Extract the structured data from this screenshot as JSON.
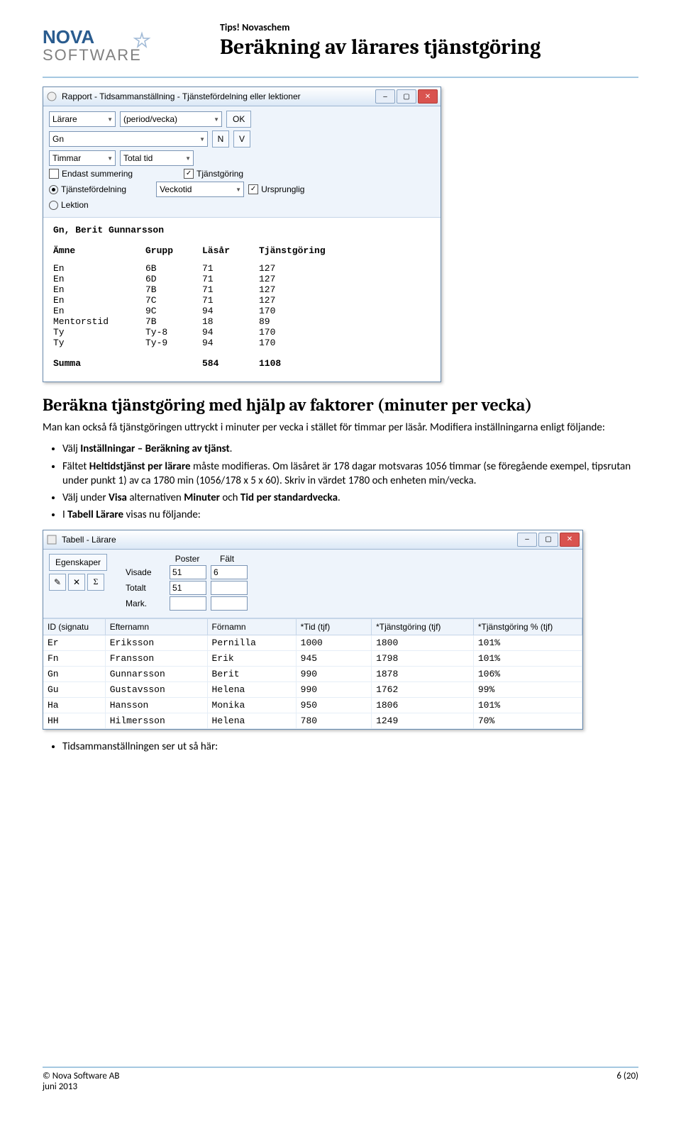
{
  "header": {
    "tips": "Tips! Novaschem",
    "title": "Beräkning av lärares tjänstgöring",
    "logo_top": "NOVA",
    "logo_bottom": "SOFTWARE"
  },
  "window1": {
    "title": "Rapport - Tidsammanställning - Tjänstefördelning eller lektioner",
    "dd_larare": "Lärare",
    "dd_period": "(period/vecka)",
    "btn_ok": "OK",
    "dd_gn": "Gn",
    "btn_n": "N",
    "btn_v": "V",
    "dd_timmar": "Timmar",
    "dd_totaltid": "Total tid",
    "chk_endast": "Endast summering",
    "chk_tjg": "Tjänstgöring",
    "radio_tjf": "Tjänstefördelning",
    "radio_lekt": "Lektion",
    "dd_veckotid": "Veckotid",
    "chk_urspr": "Ursprunglig",
    "teacher": "Gn, Berit Gunnarsson",
    "cols": {
      "amne": "Ämne",
      "grupp": "Grupp",
      "lasar": "Läsår",
      "tjg": "Tjänstgöring"
    },
    "rows": [
      {
        "a": "En",
        "g": "6B",
        "l": "71",
        "t": "127"
      },
      {
        "a": "En",
        "g": "6D",
        "l": "71",
        "t": "127"
      },
      {
        "a": "En",
        "g": "7B",
        "l": "71",
        "t": "127"
      },
      {
        "a": "En",
        "g": "7C",
        "l": "71",
        "t": "127"
      },
      {
        "a": "En",
        "g": "9C",
        "l": "94",
        "t": "170"
      },
      {
        "a": "Mentorstid",
        "g": "7B",
        "l": "18",
        "t": "89"
      },
      {
        "a": "Ty",
        "g": "Ty-8",
        "l": "94",
        "t": "170"
      },
      {
        "a": "Ty",
        "g": "Ty-9",
        "l": "94",
        "t": "170"
      }
    ],
    "sum_label": "Summa",
    "sum_l": "584",
    "sum_t": "1108"
  },
  "section": {
    "title": "Beräkna tjänstgöring med hjälp av faktorer (minuter per vecka)",
    "para": "Man kan också få tjänstgöringen uttryckt i minuter per vecka i stället för timmar per läsår. Modifiera inställningarna enligt följande:",
    "b1a": "Välj ",
    "b1b": "Inställningar – Beräkning av tjänst",
    "b1c": ".",
    "b2a": "Fältet ",
    "b2b": "Heltidstjänst per lärare",
    "b2c": " måste modifieras. Om läsåret är 178 dagar motsvaras 1056 timmar (se föregående exempel, tipsrutan under punkt 1) av ca 1780 min (1056/178 x 5 x 60). Skriv in värdet 1780 och enheten min/vecka.",
    "b3a": "Välj under ",
    "b3b": "Visa",
    "b3c": " alternativen ",
    "b3d": "Minuter",
    "b3e": " och ",
    "b3f": "Tid per standardvecka",
    "b3g": ".",
    "b4a": "I ",
    "b4b": "Tabell Lärare",
    "b4c": " visas nu följande:",
    "last": "Tidsammanställningen ser ut så här:"
  },
  "window2": {
    "title": "Tabell - Lärare",
    "btn_eg": "Egenskaper",
    "lbl_poster": "Poster",
    "lbl_falt": "Fält",
    "lbl_visade": "Visade",
    "lbl_totalt": "Totalt",
    "lbl_mark": "Mark.",
    "v_pv": "51",
    "v_pf": "6",
    "v_tv": "51",
    "v_tf": "",
    "v_mv": "",
    "v_mf": "",
    "sigma": "Σ",
    "cols": {
      "id": "ID (signatu",
      "eft": "Efternamn",
      "for": "Förnamn",
      "tid": "*Tid (tjf)",
      "tjg": "*Tjänstgöring (tjf)",
      "pct": "*Tjänstgöring % (tjf)"
    },
    "rows": [
      {
        "id": "Er",
        "e": "Eriksson",
        "f": "Pernilla",
        "t": "1000",
        "tj": "1800",
        "p": "101%"
      },
      {
        "id": "Fn",
        "e": "Fransson",
        "f": "Erik",
        "t": "945",
        "tj": "1798",
        "p": "101%"
      },
      {
        "id": "Gn",
        "e": "Gunnarsson",
        "f": "Berit",
        "t": "990",
        "tj": "1878",
        "p": "106%"
      },
      {
        "id": "Gu",
        "e": "Gustavsson",
        "f": "Helena",
        "t": "990",
        "tj": "1762",
        "p": "99%"
      },
      {
        "id": "Ha",
        "e": "Hansson",
        "f": "Monika",
        "t": "950",
        "tj": "1806",
        "p": "101%"
      },
      {
        "id": "HH",
        "e": "Hilmersson",
        "f": "Helena",
        "t": "780",
        "tj": "1249",
        "p": "70%"
      }
    ]
  },
  "footer": {
    "left": "© Nova Software AB",
    "date": "juni 2013",
    "right": "6 (20)"
  }
}
